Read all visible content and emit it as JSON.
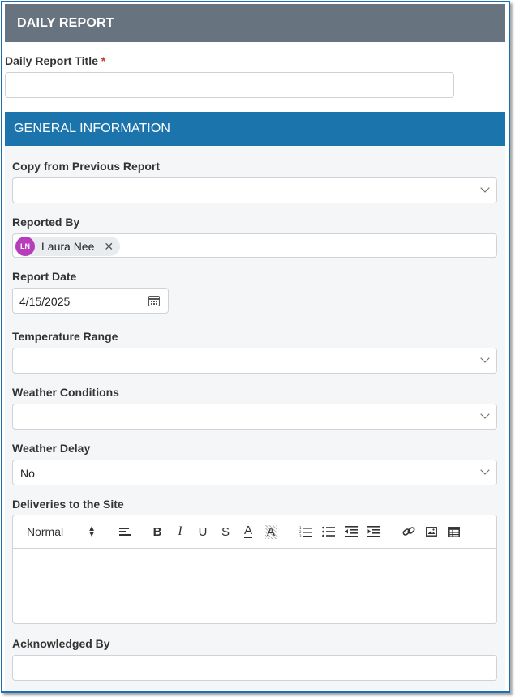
{
  "header": {
    "title": "DAILY REPORT"
  },
  "title_field": {
    "label": "Daily Report Title",
    "required_mark": "*",
    "value": ""
  },
  "section": {
    "title": "GENERAL INFORMATION"
  },
  "fields": {
    "copy_from": {
      "label": "Copy from Previous Report",
      "value": ""
    },
    "reported_by": {
      "label": "Reported By",
      "chip_initials": "LN",
      "chip_name": "Laura Nee",
      "remove_glyph": "✕"
    },
    "report_date": {
      "label": "Report Date",
      "value": "4/15/2025"
    },
    "temperature_range": {
      "label": "Temperature Range",
      "value": ""
    },
    "weather_conditions": {
      "label": "Weather Conditions",
      "value": ""
    },
    "weather_delay": {
      "label": "Weather Delay",
      "value": "No"
    },
    "deliveries": {
      "label": "Deliveries to the Site",
      "format_value": "Normal",
      "body": ""
    },
    "acknowledged_by": {
      "label": "Acknowledged By",
      "value": ""
    }
  },
  "toolbar": {
    "bold": "B",
    "italic": "I",
    "underline": "U",
    "strike": "S",
    "font_color": "A",
    "highlight": "A",
    "icons": [
      "align-left-icon",
      "bold-icon",
      "italic-icon",
      "underline-icon",
      "strikethrough-icon",
      "font-color-icon",
      "highlight-icon",
      "ordered-list-icon",
      "bullet-list-icon",
      "outdent-icon",
      "indent-icon",
      "link-icon",
      "image-icon",
      "table-icon"
    ]
  },
  "colors": {
    "header_bg": "#67737f",
    "section_bg": "#1b74ac",
    "avatar": "#b83dba",
    "required": "#c0392b"
  }
}
